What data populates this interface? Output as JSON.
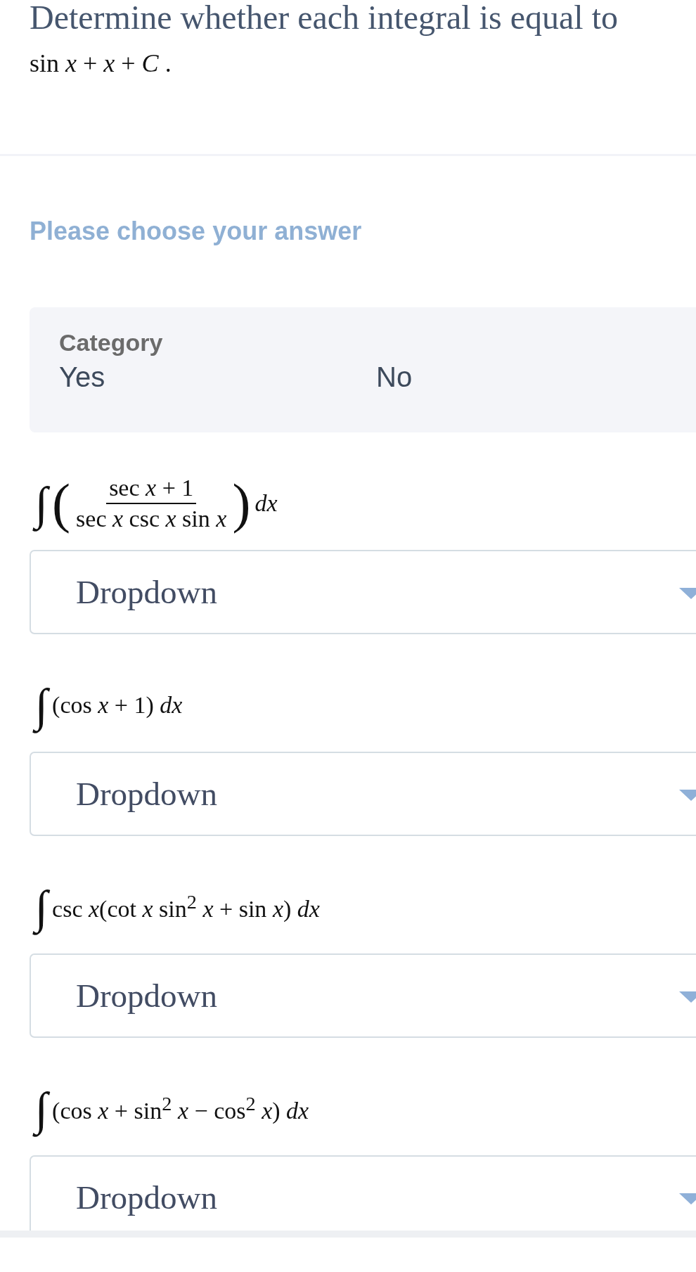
{
  "question": {
    "text": "Determine whether each integral is equal to",
    "expression": "sin *x* + *x* + *C* ."
  },
  "prompt": "Please choose your answer",
  "category": {
    "label": "Category",
    "columns": [
      "Yes",
      "No"
    ]
  },
  "items": [
    {
      "formula": {
        "kind": "fraction",
        "sign": "∫",
        "open": "(",
        "numerator": "sec *x* + 1",
        "denominator": "sec *x* csc *x* sin *x*",
        "close": ")",
        "suffix": "*dx*"
      },
      "dropdown": {
        "value": "Dropdown"
      }
    },
    {
      "formula": {
        "kind": "inline",
        "sign": "∫",
        "body": "(cos *x* + 1) *dx*"
      },
      "dropdown": {
        "value": "Dropdown"
      }
    },
    {
      "formula": {
        "kind": "inline",
        "sign": "∫",
        "body": "csc *x*(cot *x* sin$^{2}$ *x* + sin *x*) *dx*"
      },
      "dropdown": {
        "value": "Dropdown"
      }
    },
    {
      "formula": {
        "kind": "inline",
        "sign": "∫",
        "body": "(cos *x* + sin$^{2}$ *x* − cos$^{2}$ *x*) *dx*"
      },
      "dropdown": {
        "value": "Dropdown"
      }
    }
  ]
}
